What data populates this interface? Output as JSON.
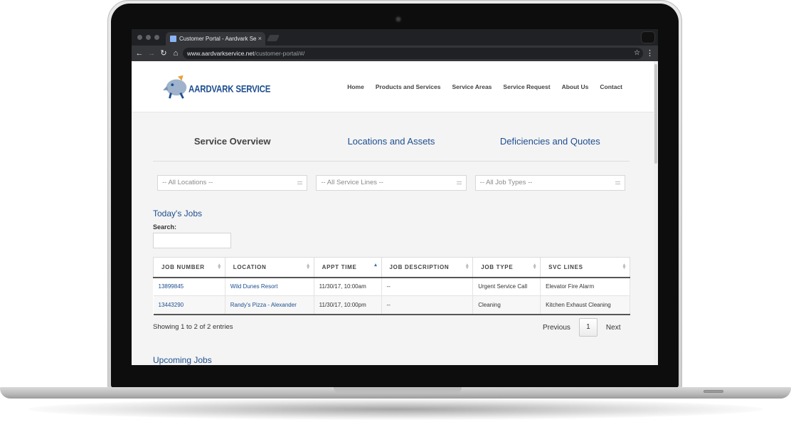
{
  "browser": {
    "tab_title": "Customer Portal - Aardvark Se",
    "tab_close": "×",
    "url_domain": "www.aardvarkservice.net",
    "url_path": "/customer-portal/#/",
    "back_glyph": "←",
    "forward_glyph": "→",
    "reload_glyph": "↻",
    "home_glyph": "⌂",
    "star_glyph": "☆",
    "menu_glyph": "⋮"
  },
  "site": {
    "logo_text": "AARDVARK SERVICE",
    "nav": [
      "Home",
      "Products and Services",
      "Service Areas",
      "Service Request",
      "About Us",
      "Contact"
    ]
  },
  "portal_tabs": [
    "Service Overview",
    "Locations and Assets",
    "Deficiencies and Quotes"
  ],
  "filters": {
    "locations": "-- All Locations --",
    "service_lines": "-- All Service Lines --",
    "job_types": "-- All Job Types --"
  },
  "todays_jobs": {
    "title": "Today's Jobs",
    "search_label": "Search:",
    "columns": [
      "JOB NUMBER",
      "LOCATION",
      "APPT TIME",
      "JOB DESCRIPTION",
      "JOB TYPE",
      "SVC LINES"
    ],
    "rows": [
      {
        "job_number": "13899845",
        "location": "Wild Dunes Resort",
        "appt_time": "11/30/17, 10:00am",
        "description": "--",
        "job_type": "Urgent Service Call",
        "svc_lines": "Elevator Fire Alarm"
      },
      {
        "job_number": "13443290",
        "location": "Randy's Pizza - Alexander",
        "appt_time": "11/30/17, 10:00pm",
        "description": "--",
        "job_type": "Cleaning",
        "svc_lines": "Kitchen Exhaust Cleaning"
      }
    ],
    "showing": "Showing 1 to 2 of 2 entries",
    "pager": {
      "previous": "Previous",
      "page": "1",
      "next": "Next"
    }
  },
  "upcoming_jobs": {
    "title": "Upcoming Jobs"
  },
  "colors": {
    "brand": "#1d4e8f",
    "text": "#333333",
    "background": "#f4f4f4"
  }
}
